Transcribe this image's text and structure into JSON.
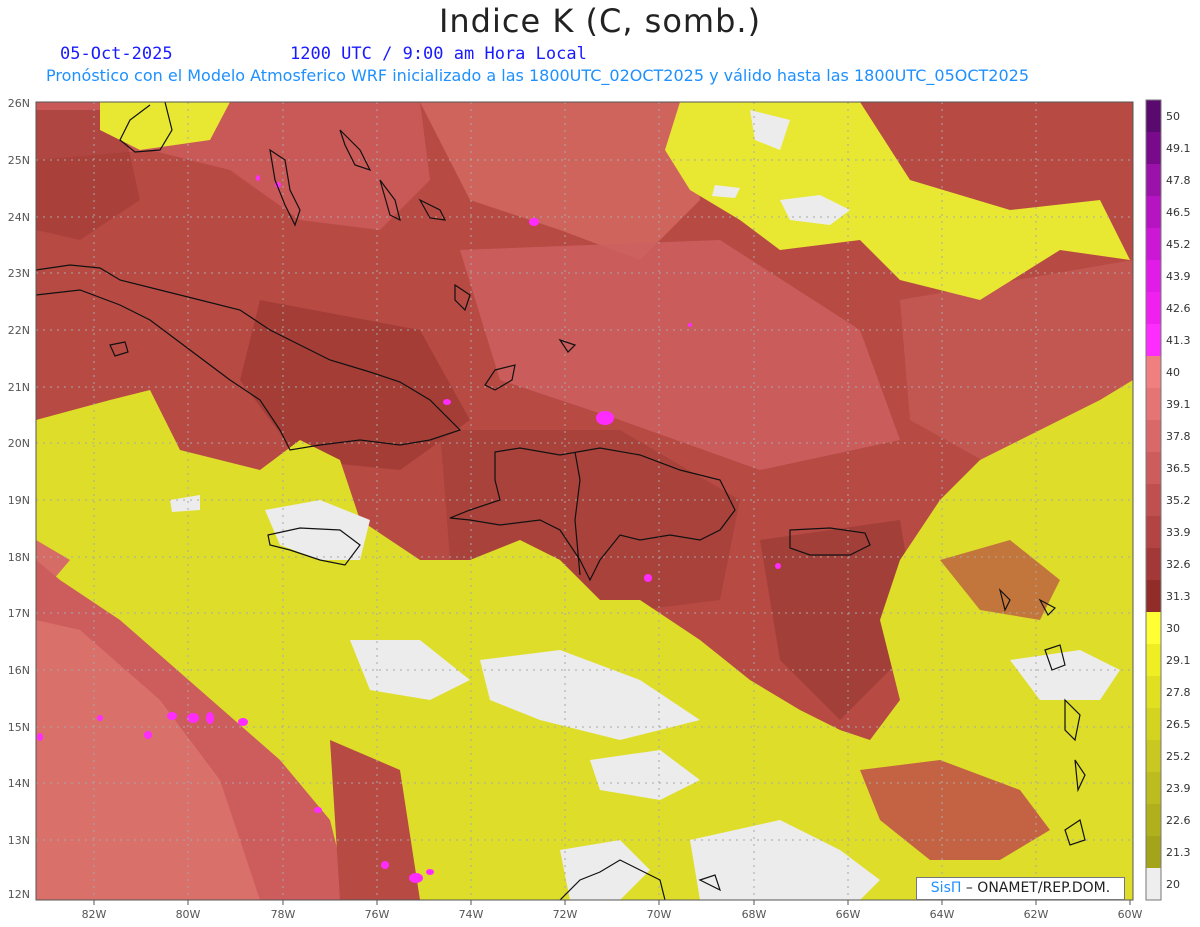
{
  "header": {
    "title": "Indice K (C, somb.)",
    "date": "05-Oct-2025",
    "time": "1200 UTC / 9:00 am Hora Local",
    "subtitle": "Pronóstico con el Modelo Atmosferico WRF inicializado a las 1800UTC_02OCT2025 y válido hasta las  1800UTC_05OCT2025"
  },
  "map": {
    "lon_labels": [
      "82W",
      "80W",
      "78W",
      "76W",
      "74W",
      "72W",
      "70W",
      "68W",
      "66W",
      "64W",
      "62W",
      "60W"
    ],
    "lat_labels": [
      "26N",
      "25N",
      "24N",
      "23N",
      "22N",
      "21N",
      "20N",
      "19N",
      "18N",
      "17N",
      "16N",
      "15N",
      "14N",
      "13N",
      "12N"
    ]
  },
  "colorbar": {
    "labels": [
      "50",
      "49.1",
      "47.8",
      "46.5",
      "45.2",
      "43.9",
      "42.6",
      "41.3",
      "40",
      "39.1",
      "37.8",
      "36.5",
      "35.2",
      "33.9",
      "32.6",
      "31.3",
      "30",
      "29.1",
      "27.8",
      "26.5",
      "25.2",
      "23.9",
      "22.6",
      "21.3",
      "20"
    ],
    "colors": [
      "#5a0a6e",
      "#7a0a8c",
      "#9a12aa",
      "#b614c2",
      "#cc18d6",
      "#e21ce8",
      "#f020f0",
      "#ff2cff",
      "#f08080",
      "#e57474",
      "#d96868",
      "#cd5c5c",
      "#c05050",
      "#b24444",
      "#a23838",
      "#922c28",
      "#ffff33",
      "#eeee22",
      "#e0e020",
      "#d4d420",
      "#c8c820",
      "#bcbc1e",
      "#b0b01c",
      "#a4a41a",
      "#eeeeee"
    ]
  },
  "credit": {
    "brand": "SisΠ",
    "text": "– ONAMET/REP.DOM."
  }
}
